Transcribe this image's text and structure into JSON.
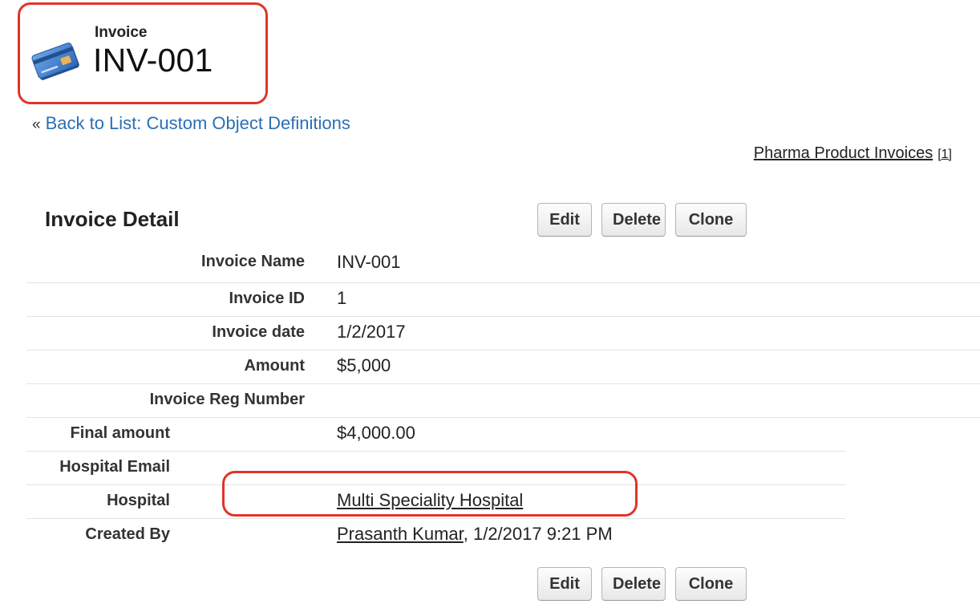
{
  "header": {
    "object_type": "Invoice",
    "record_name": "INV-001",
    "icon": "credit-card-icon"
  },
  "nav": {
    "back_arrow": "«",
    "back_link": "Back to List: Custom Object Definitions",
    "related_list": "Pharma Product Invoices",
    "related_count": "[1]"
  },
  "detail": {
    "title": "Invoice Detail",
    "buttons": {
      "edit": "Edit",
      "delete": "Delete",
      "clone": "Clone"
    },
    "fields": [
      {
        "label": "Invoice Name",
        "value": "INV-001"
      },
      {
        "label": "Invoice ID",
        "value": "1"
      },
      {
        "label": "Invoice date",
        "value": "1/2/2017"
      },
      {
        "label": "Amount",
        "value": "$5,000"
      },
      {
        "label": "Invoice Reg Number",
        "value": ""
      },
      {
        "label": "Final amount",
        "value": "$4,000.00"
      },
      {
        "label": "Hospital Email",
        "value": ""
      },
      {
        "label": "Hospital",
        "value": "Multi Speciality Hospital"
      },
      {
        "label": "Created By",
        "value_link": "Prasanth Kumar",
        "value_suffix": ", 1/2/2017 9:21 PM"
      }
    ]
  },
  "colors": {
    "highlight": "#e0342b",
    "link": "#2a6fb3",
    "card_icon": "#3f7fd0"
  }
}
